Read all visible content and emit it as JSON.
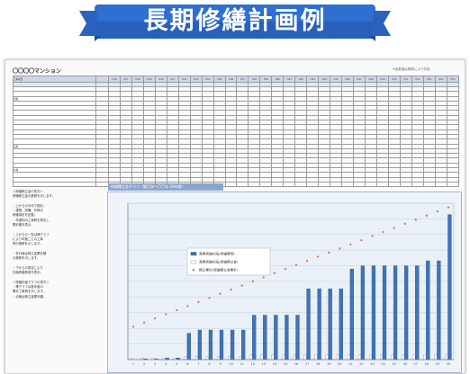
{
  "banner": {
    "title": "長期修繕計画例"
  },
  "sheet": {
    "mansion_name": "〇〇〇〇マンション",
    "caption_bar": "長期修繕計画表（築〇年〜〇〇年 30年間）",
    "right_note": "※各数値は概算により作成",
    "table": {
      "row_labels": [
        "工事項目",
        "",
        "",
        "建物",
        "",
        "",
        "",
        "",
        "",
        "",
        "",
        "",
        "",
        "設備",
        "",
        "",
        "",
        "",
        "外構",
        "",
        "",
        "",
        "",
        "",
        "",
        "合計",
        "",
        "",
        "",
        ""
      ],
      "years": [
        "H26",
        "H27",
        "H28",
        "H29",
        "H30",
        "H31",
        "H32",
        "H33",
        "H34",
        "H35",
        "H36",
        "H37",
        "H38",
        "H39",
        "H40",
        "H41",
        "H42",
        "H43",
        "H44",
        "H45",
        "H46",
        "H47",
        "H48",
        "H49",
        "H50",
        "H51",
        "H52",
        "H53",
        "H54",
        "H55"
      ]
    },
    "left_note_lines": [
      "＜修繕積立金の見方＞",
      "修繕積立金の推移を示します。",
      "",
      "・上からの平均で推計。",
      "・建物、設備、外構の",
      "  修繕項目を記載。",
      "・年度別の工事費を算出し",
      "  累計額を表示。",
      "",
      "・上からの一覧は棒グラフ",
      "  により年度ごとの工事",
      "  費の推移を示します。",
      "",
      "・折れ線は積立金累計額",
      "  の推移を示します。",
      "",
      "・下からの算定により",
      "  計画修繕費用を表示。",
      "",
      "＜修繕計画グラフの見方＞",
      "・棒グラフは各年度の",
      "  累計工事費を示します。",
      "・点線は積立金累計額。"
    ],
    "chart_caption": "修繕積立金グラフ（築〇年〜〇〇年 30年間）",
    "chart_data": {
      "type": "bar",
      "categories": [
        "1",
        "2",
        "3",
        "4",
        "5",
        "6",
        "7",
        "8",
        "9",
        "10",
        "11",
        "12",
        "13",
        "14",
        "15",
        "16",
        "17",
        "18",
        "19",
        "20",
        "21",
        "22",
        "23",
        "24",
        "25",
        "26",
        "27",
        "28",
        "29",
        "30"
      ],
      "series": [
        {
          "name": "",
          "values": [
            0,
            0.5,
            0.5,
            1,
            1,
            16,
            18,
            18,
            18,
            18,
            18,
            27,
            27,
            27,
            27,
            27,
            43,
            43,
            43,
            43,
            55,
            57,
            57,
            57,
            57,
            57,
            57,
            60,
            60,
            88
          ]
        },
        {
          "name": "",
          "values": [
            1,
            1,
            1,
            1,
            1,
            2,
            2,
            2,
            2,
            2,
            2,
            3,
            3,
            3,
            3,
            3,
            3,
            3,
            3,
            3,
            3,
            3,
            3,
            3,
            3,
            3,
            3,
            3,
            3,
            3
          ]
        },
        {
          "name": "",
          "values": [
            20,
            22.5,
            25,
            27.5,
            30,
            32.5,
            35,
            37.5,
            40,
            42.5,
            45,
            47.5,
            50,
            52.5,
            55,
            57.5,
            60,
            62.5,
            65,
            67.5,
            70,
            72.5,
            75,
            77.5,
            80,
            82.5,
            85,
            87.5,
            90,
            92.5
          ]
        }
      ],
      "legend": [
        "長期修繕計画(修繕費用)",
        "長期修繕計画(修繕積立金)",
        "積立累計(修繕積立金累計)"
      ],
      "ylabels": [
        "",
        "",
        "",
        "",
        "",
        "",
        "",
        "",
        "",
        ""
      ],
      "ylim": [
        0,
        95
      ],
      "grid": true,
      "colors": {
        "bar_main": "#3f74b9",
        "bar_light": "#ffffff",
        "dots": "#d7702e"
      }
    }
  }
}
